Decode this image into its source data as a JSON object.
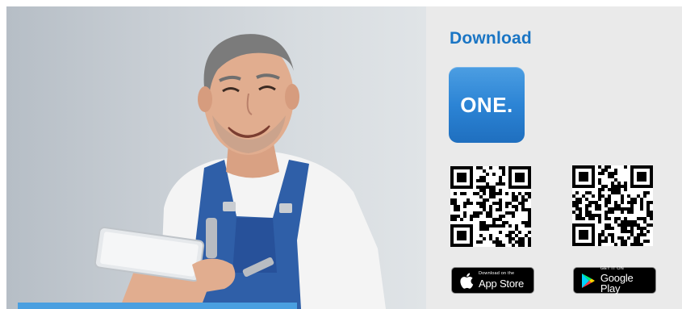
{
  "photo": {
    "alt": "Smiling mechanic in blue overalls holding a tablet"
  },
  "download": {
    "title": "Download",
    "app_icon_label": "ONE.",
    "qr_codes": [
      {
        "name": "qr-code-app-store",
        "icon": "qr-code-icon"
      },
      {
        "name": "qr-code-google-play",
        "icon": "qr-code-icon"
      }
    ],
    "app_store": {
      "small_text": "Download on the",
      "big_text": "App Store",
      "icon": "apple-icon"
    },
    "google_play": {
      "small_text": "GET IT ON",
      "big_text": "Google Play",
      "icon": "google-play-icon"
    }
  },
  "colors": {
    "accent": "#1a75c4",
    "panel_bg": "#eaeaea",
    "overall_blue": "#2f5fa8",
    "caption_bar": "#4a9fe0"
  }
}
